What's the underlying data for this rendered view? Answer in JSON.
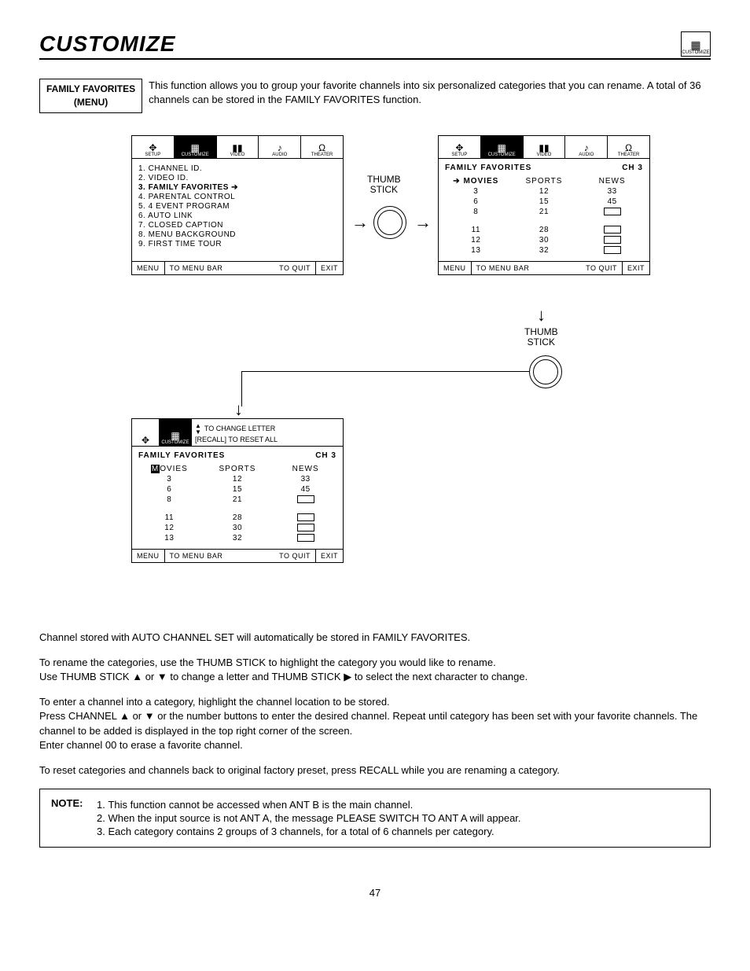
{
  "page_title": "CUSTOMIZE",
  "corner_icon_label": "CUSTOMIZE",
  "section_label_line1": "FAMILY FAVORITES",
  "section_label_line2": "(MENU)",
  "intro_text": "This function allows you to group your favorite channels into six personalized categories that you can rename. A total of 36 channels can be stored in the FAMILY FAVORITES function.",
  "tabs": {
    "setup": "SETUP",
    "customize": "CUSTOMIZE",
    "video": "VIDEO",
    "audio": "AUDIO",
    "theater": "THEATER"
  },
  "menu_panel": {
    "items": [
      "1. CHANNEL ID.",
      "2. VIDEO ID.",
      "3. FAMILY FAVORITES",
      "4. PARENTAL CONTROL",
      "5. 4 EVENT PROGRAM",
      "6. AUTO LINK",
      "7. CLOSED CAPTION",
      "8. MENU BACKGROUND",
      "9. FIRST TIME TOUR"
    ],
    "selected_index": 2
  },
  "footer": {
    "menu": "MENU",
    "to_menu_bar": "TO MENU BAR",
    "to_quit": "TO QUIT",
    "exit": "EXIT"
  },
  "thumb_label": "THUMB\nSTICK",
  "ff_panel": {
    "title": "FAMILY FAVORITES",
    "channel": "CH   3",
    "categories": [
      "MOVIES",
      "SPORTS",
      "NEWS"
    ],
    "cols": [
      [
        "3",
        "6",
        "8",
        "",
        "11",
        "12",
        "13"
      ],
      [
        "12",
        "15",
        "21",
        "",
        "28",
        "30",
        "32"
      ],
      [
        "33",
        "45",
        "□",
        "",
        "□",
        "□",
        "□"
      ]
    ]
  },
  "edit_panel": {
    "hint1": "TO CHANGE LETTER",
    "hint2": "[RECALL] TO RESET ALL",
    "highlight_char": "M",
    "rest_word": "OVIES"
  },
  "body": {
    "p1": "Channel stored with AUTO CHANNEL SET will automatically be stored in FAMILY FAVORITES.",
    "p2a": "To rename the categories, use the THUMB STICK to highlight the category you would like to rename.",
    "p2b": "Use THUMB STICK ▲ or ▼ to change a letter and THUMB STICK ▶ to select the next character to change.",
    "p3a": "To enter a channel into a category, highlight the channel location to be stored.",
    "p3b": "Press CHANNEL ▲ or ▼ or the number buttons to enter the desired channel.  Repeat until category has been set with your favorite channels.  The channel to be added is displayed in the top right corner of the screen.",
    "p3c": "Enter channel 00 to erase a favorite channel.",
    "p4": "To reset categories and channels back to original factory preset, press RECALL while you are renaming a category."
  },
  "note": {
    "label": "NOTE:",
    "items": [
      "This function cannot be accessed when ANT B is the main channel.",
      "When the input source is not ANT A, the message  PLEASE SWITCH TO ANT A  will appear.",
      "Each category contains 2 groups of 3 channels, for a total of 6 channels per category."
    ]
  },
  "page_number": "47"
}
